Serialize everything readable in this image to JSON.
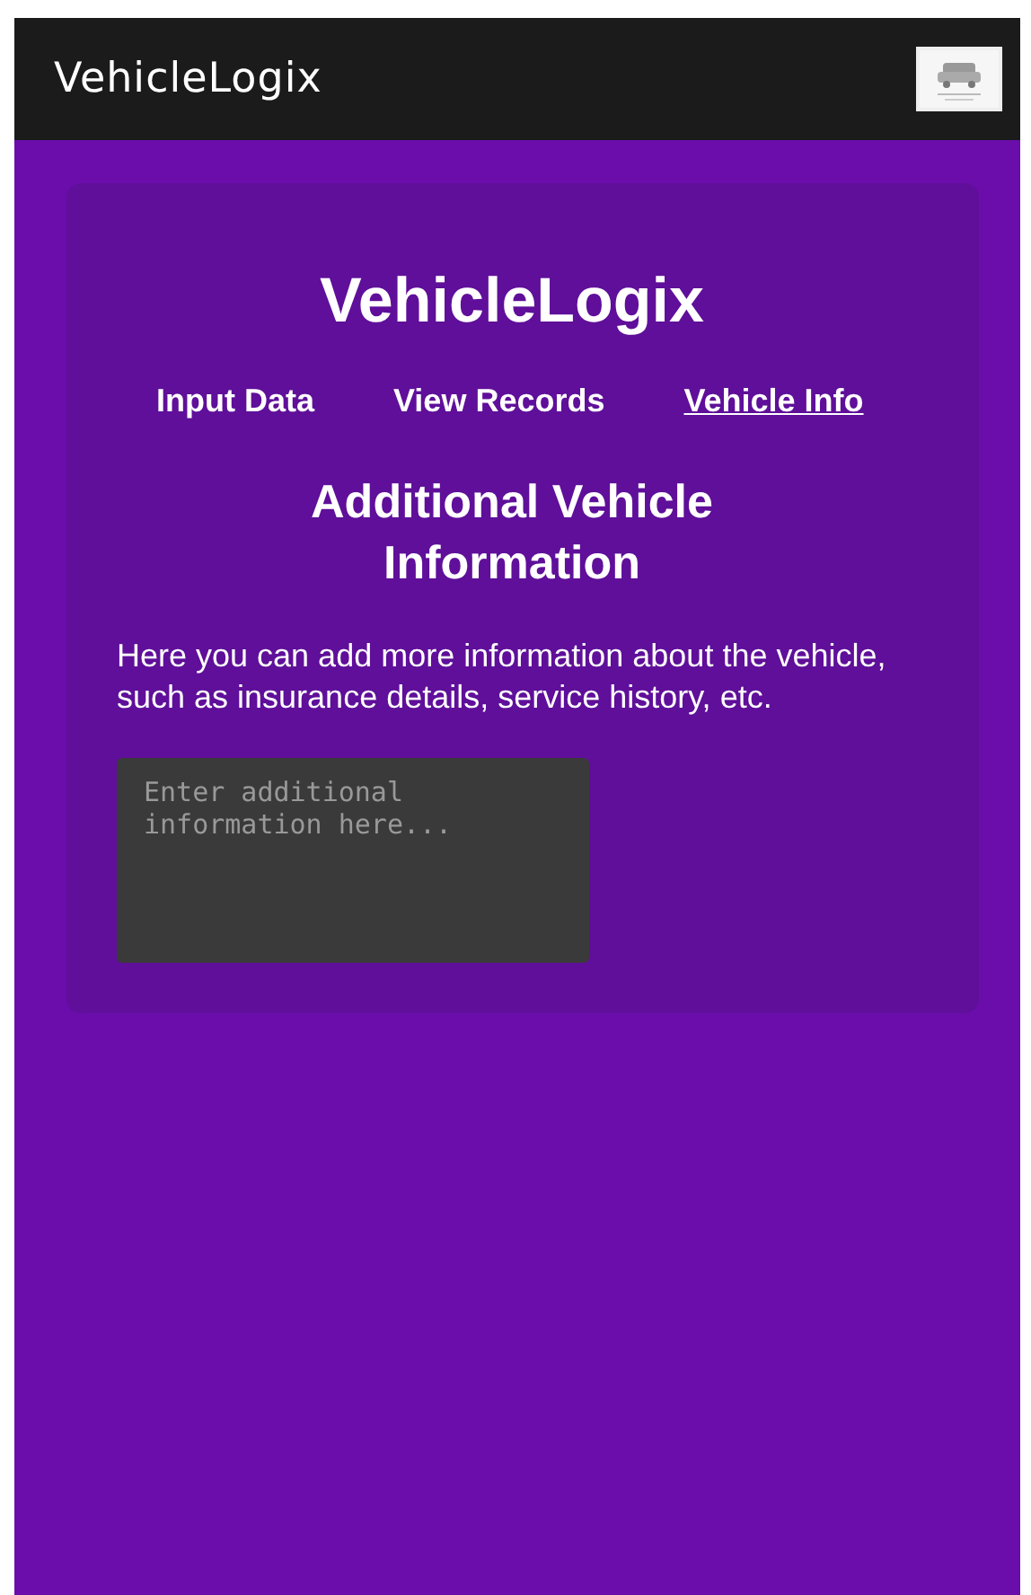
{
  "app_bar": {
    "title": "VehicleLogix"
  },
  "card": {
    "title": "VehicleLogix",
    "nav": [
      {
        "label": "Input Data",
        "selected": false
      },
      {
        "label": "View Records",
        "selected": false
      },
      {
        "label": "Vehicle Info",
        "selected": true
      }
    ],
    "heading": "Additional Vehicle Information",
    "description": "Here you can add more information about the vehicle, such as insurance details, service history, etc.",
    "notes_field": {
      "placeholder": "Enter additional information here..."
    }
  }
}
